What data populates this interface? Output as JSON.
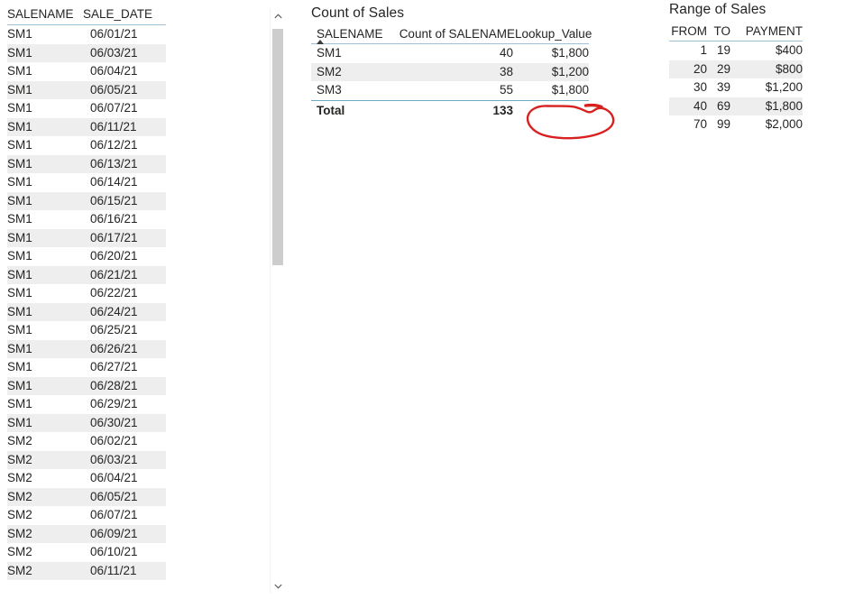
{
  "left_table": {
    "name": "sales-detail-table",
    "columns": [
      "SALENAME",
      "SALE_DATE"
    ],
    "rows": [
      [
        "SM1",
        "06/01/21"
      ],
      [
        "SM1",
        "06/03/21"
      ],
      [
        "SM1",
        "06/04/21"
      ],
      [
        "SM1",
        "06/05/21"
      ],
      [
        "SM1",
        "06/07/21"
      ],
      [
        "SM1",
        "06/11/21"
      ],
      [
        "SM1",
        "06/12/21"
      ],
      [
        "SM1",
        "06/13/21"
      ],
      [
        "SM1",
        "06/14/21"
      ],
      [
        "SM1",
        "06/15/21"
      ],
      [
        "SM1",
        "06/16/21"
      ],
      [
        "SM1",
        "06/17/21"
      ],
      [
        "SM1",
        "06/20/21"
      ],
      [
        "SM1",
        "06/21/21"
      ],
      [
        "SM1",
        "06/22/21"
      ],
      [
        "SM1",
        "06/24/21"
      ],
      [
        "SM1",
        "06/25/21"
      ],
      [
        "SM1",
        "06/26/21"
      ],
      [
        "SM1",
        "06/27/21"
      ],
      [
        "SM1",
        "06/28/21"
      ],
      [
        "SM1",
        "06/29/21"
      ],
      [
        "SM1",
        "06/30/21"
      ],
      [
        "SM2",
        "06/02/21"
      ],
      [
        "SM2",
        "06/03/21"
      ],
      [
        "SM2",
        "06/04/21"
      ],
      [
        "SM2",
        "06/05/21"
      ],
      [
        "SM2",
        "06/07/21"
      ],
      [
        "SM2",
        "06/09/21"
      ],
      [
        "SM2",
        "06/10/21"
      ],
      [
        "SM2",
        "06/11/21"
      ]
    ]
  },
  "scrollbar": {
    "up_arrow": "⌃",
    "down_arrow": "⌄"
  },
  "count_visual": {
    "title": "Count of Sales",
    "columns": [
      "SALENAME",
      "Count of SALENAME",
      "Lookup_Value"
    ],
    "sort_indicator": "ascending",
    "rows": [
      [
        "SM1",
        "40",
        "$1,800"
      ],
      [
        "SM2",
        "38",
        "$1,200"
      ],
      [
        "SM3",
        "55",
        "$1,800"
      ]
    ],
    "total": [
      "Total",
      "133",
      ""
    ]
  },
  "range_visual": {
    "title": "Range of Sales",
    "columns": [
      "FROM",
      "TO",
      "PAYMENT"
    ],
    "rows": [
      [
        "1",
        "19",
        "$400"
      ],
      [
        "20",
        "29",
        "$800"
      ],
      [
        "30",
        "39",
        "$1,200"
      ],
      [
        "40",
        "69",
        "$1,800"
      ],
      [
        "70",
        "99",
        "$2,000"
      ]
    ]
  },
  "annotation": {
    "shape": "hand-drawn-ellipse",
    "color": "#d8201f",
    "target": "empty Lookup_Value cell in Total row"
  },
  "colors": {
    "header_rule": "#9fc4d8",
    "total_rule": "#6ea8c4",
    "alt_row": "#eeeeee",
    "text": "#252423",
    "scroll_thumb": "#cdcdcd",
    "annotation_red": "#d8201f"
  }
}
